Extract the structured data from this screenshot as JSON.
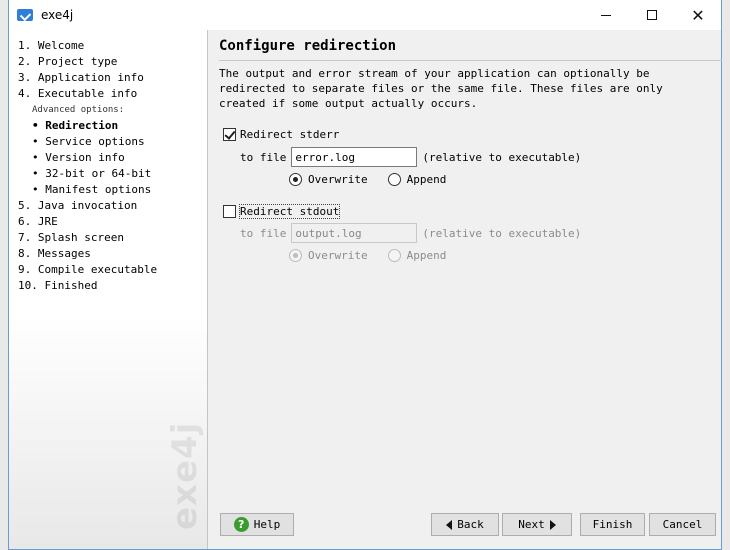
{
  "window": {
    "title": "exe4j"
  },
  "sidebar": {
    "steps": [
      {
        "label": "1. Welcome",
        "kind": "step"
      },
      {
        "label": "2. Project type",
        "kind": "step"
      },
      {
        "label": "3. Application info",
        "kind": "step"
      },
      {
        "label": "4. Executable info",
        "kind": "step"
      },
      {
        "label": "Advanced options:",
        "kind": "adv"
      },
      {
        "label": "• Redirection",
        "kind": "sub-active"
      },
      {
        "label": "• Service options",
        "kind": "sub"
      },
      {
        "label": "• Version info",
        "kind": "sub"
      },
      {
        "label": "• 32-bit or 64-bit",
        "kind": "sub"
      },
      {
        "label": "• Manifest options",
        "kind": "sub"
      },
      {
        "label": "5. Java invocation",
        "kind": "step"
      },
      {
        "label": "6. JRE",
        "kind": "step"
      },
      {
        "label": "7. Splash screen",
        "kind": "step"
      },
      {
        "label": "8. Messages",
        "kind": "step"
      },
      {
        "label": "9. Compile executable",
        "kind": "step"
      },
      {
        "label": "10. Finished",
        "kind": "step"
      }
    ],
    "logo_text": "exe4j"
  },
  "main": {
    "heading": "Configure redirection",
    "intro": "The output and error stream of your application can optionally be redirected to separate files or the same file. These files are only created if some output actually occurs.",
    "stderr": {
      "label": "Redirect stderr",
      "checked": true,
      "to_file_label": "to file",
      "file_value": "error.log",
      "relative_note": "(relative to executable)",
      "overwrite_label": "Overwrite",
      "append_label": "Append"
    },
    "stdout": {
      "label": "Redirect stdout",
      "checked": false,
      "to_file_label": "to file",
      "file_value": "output.log",
      "relative_note": "(relative to executable)",
      "overwrite_label": "Overwrite",
      "append_label": "Append"
    }
  },
  "footer": {
    "help": "Help",
    "back": "Back",
    "next": "Next",
    "finish": "Finish",
    "cancel": "Cancel"
  }
}
